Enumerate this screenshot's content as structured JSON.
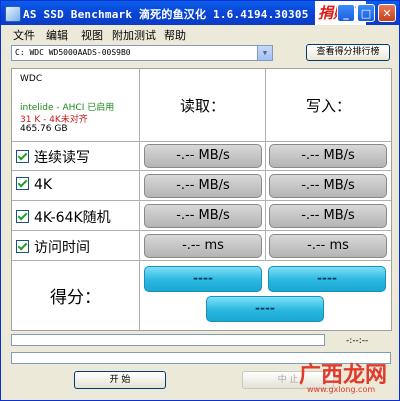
{
  "window": {
    "title": "AS SSD Benchmark 滴死的鱼汉化 1.6.4194.30305",
    "donate_label": "捐赠！"
  },
  "menu": {
    "items": [
      "文件",
      "编辑",
      "视图",
      "附加测试",
      "帮助"
    ]
  },
  "drive": {
    "selected": "C: WDC WD5000AADS-00S9B0",
    "rank_button_label": "查看得分排行榜"
  },
  "drive_info": {
    "vendor": "WDC",
    "ahci_status": "intelide - AHCI 已启用",
    "alignment": "31 K - 4K未对齐",
    "capacity": "465.76 GB"
  },
  "columns": {
    "read": "读取：",
    "write": "写入："
  },
  "tests": [
    {
      "label": "连续读写",
      "checked": true,
      "read": "-.-- MB/s",
      "write": "-.-- MB/s"
    },
    {
      "label": "4K",
      "checked": true,
      "read": "-.-- MB/s",
      "write": "-.-- MB/s"
    },
    {
      "label": "4K-64K随机",
      "checked": true,
      "read": "-.-- MB/s",
      "write": "-.-- MB/s"
    },
    {
      "label": "访问时间",
      "checked": true,
      "read": "-.-- ms",
      "write": "-.-- ms"
    }
  ],
  "score": {
    "label": "得分：",
    "read": "----",
    "write": "----",
    "total": "----"
  },
  "progress": {
    "elapsed": "-:--:--"
  },
  "buttons": {
    "start": "开 始",
    "stop": "中 止"
  },
  "watermark": {
    "text": "广西龙网",
    "sub": "www.gxlong.com"
  },
  "colors": {
    "titlebar": "#0a46d8",
    "result_box": "#c4c4c4",
    "score_box": "#2ab8e0",
    "donate": "#e01818"
  }
}
